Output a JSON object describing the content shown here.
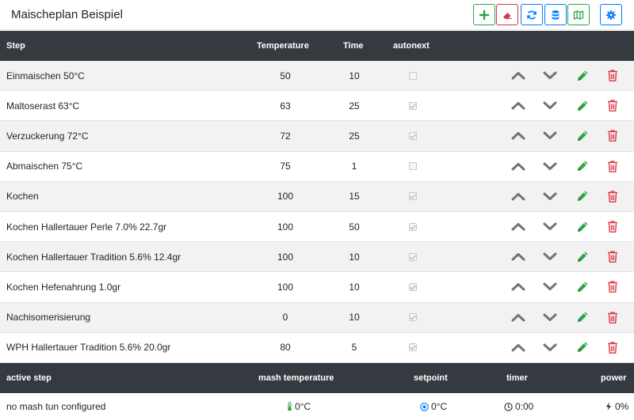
{
  "header": {
    "title": "Maischeplan Beispiel"
  },
  "toolbar": [
    {
      "name": "add-step-button",
      "icon": "plus-icon"
    },
    {
      "name": "clear-button",
      "icon": "eraser-icon"
    },
    {
      "name": "refresh-button",
      "icon": "sync-icon"
    },
    {
      "name": "database-button",
      "icon": "database-icon"
    },
    {
      "name": "map-button",
      "icon": "map-icon"
    },
    {
      "name": "settings-button",
      "icon": "gear-icon"
    }
  ],
  "steps_table": {
    "columns": {
      "step": "Step",
      "temperature": "Temperature",
      "time": "Time",
      "autonext": "autonext"
    },
    "rows": [
      {
        "name": "Einmaischen 50°C",
        "temperature": "50",
        "time": "10",
        "autonext": false
      },
      {
        "name": "Maltoserast 63°C",
        "temperature": "63",
        "time": "25",
        "autonext": true
      },
      {
        "name": "Verzuckerung 72°C",
        "temperature": "72",
        "time": "25",
        "autonext": true
      },
      {
        "name": "Abmaischen 75°C",
        "temperature": "75",
        "time": "1",
        "autonext": false
      },
      {
        "name": "Kochen",
        "temperature": "100",
        "time": "15",
        "autonext": true
      },
      {
        "name": "Kochen Hallertauer Perle 7.0% 22.7gr",
        "temperature": "100",
        "time": "50",
        "autonext": true
      },
      {
        "name": "Kochen Hallertauer Tradition 5.6% 12.4gr",
        "temperature": "100",
        "time": "10",
        "autonext": true
      },
      {
        "name": "Kochen Hefenahrung 1.0gr",
        "temperature": "100",
        "time": "10",
        "autonext": true
      },
      {
        "name": "Nachisomerisierung",
        "temperature": "0",
        "time": "10",
        "autonext": true
      },
      {
        "name": "WPH Hallertauer Tradition 5.6% 20.0gr",
        "temperature": "80",
        "time": "5",
        "autonext": true
      }
    ]
  },
  "status_table": {
    "columns": {
      "active_step": "active step",
      "mash_temperature": "mash temperature",
      "setpoint": "setpoint",
      "timer": "timer",
      "power": "power"
    },
    "values": {
      "active_step": "no mash tun configured",
      "mash_temperature": "0°C",
      "setpoint": "0°C",
      "timer": "0:00",
      "power": "0%"
    }
  },
  "colors": {
    "green": "#28a745",
    "red": "#dc3545",
    "blue": "#007bff",
    "dark": "#343a40",
    "gray": "#6c757d"
  }
}
